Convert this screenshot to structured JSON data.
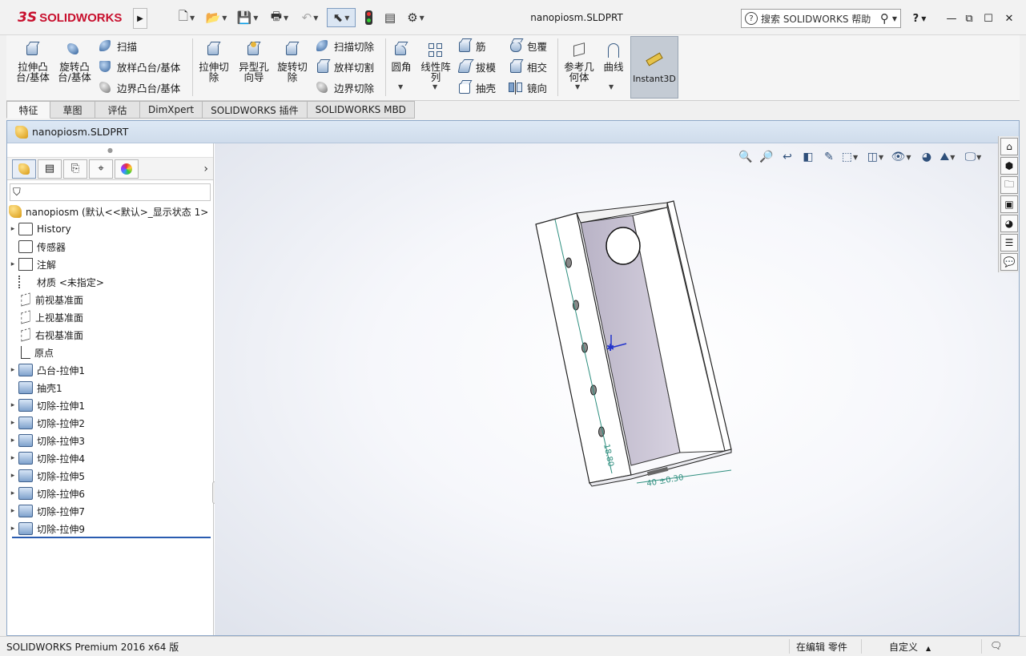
{
  "app": {
    "brand_ds": "3S",
    "brand_name": "SOLIDWORKS",
    "title": "nanopiosm.SLDPRT",
    "help_search_placeholder": "搜索 SOLIDWORKS 帮助",
    "help_label": "?"
  },
  "quick_access": [
    {
      "name": "new-icon",
      "glyph": "🗋"
    },
    {
      "name": "open-icon",
      "glyph": "📂"
    },
    {
      "name": "save-icon",
      "glyph": "💾"
    },
    {
      "name": "print-icon",
      "glyph": "🖶"
    },
    {
      "name": "undo-icon",
      "glyph": "↶"
    },
    {
      "name": "select-icon",
      "glyph": "⬉"
    },
    {
      "name": "traffic-light-icon",
      "glyph": "●"
    },
    {
      "name": "file-properties-icon",
      "glyph": "▤"
    },
    {
      "name": "options-icon",
      "glyph": "⚙"
    }
  ],
  "commands": {
    "extrude_boss": "拉伸凸\n台/基体",
    "revolve_boss": "旋转凸\n台/基体",
    "sweep": "扫描",
    "loft_boss": "放样凸台/基体",
    "boundary_boss": "边界凸台/基体",
    "extrude_cut": "拉伸切\n除",
    "hole_wizard": "异型孔\n向导",
    "revolve_cut": "旋转切\n除",
    "sweep_cut": "扫描切除",
    "loft_cut": "放样切割",
    "boundary_cut": "边界切除",
    "fillet": "圆角",
    "linear_pattern": "线性阵\n列",
    "rib": "筋",
    "draft": "拔模",
    "shell": "抽壳",
    "wrap": "包覆",
    "intersect": "相交",
    "mirror": "镜向",
    "ref_geometry": "参考几\n何体",
    "curves": "曲线",
    "instant3d": "Instant3D"
  },
  "tabs": [
    "特征",
    "草图",
    "评估",
    "DimXpert",
    "SOLIDWORKS 插件",
    "SOLIDWORKS MBD"
  ],
  "document": {
    "window_title": "nanopiosm.SLDPRT"
  },
  "feature_tree": {
    "root": "nanopiosm  (默认<<默认>_显示状态 1>",
    "items": [
      {
        "label": "History",
        "expandable": true,
        "icon": "history-icon"
      },
      {
        "label": "传感器",
        "expandable": false,
        "icon": "sensor-icon"
      },
      {
        "label": "注解",
        "expandable": true,
        "icon": "annotation-icon"
      },
      {
        "label": "材质 <未指定>",
        "expandable": false,
        "icon": "material-icon"
      },
      {
        "label": "前视基准面",
        "expandable": false,
        "icon": "plane-icon"
      },
      {
        "label": "上视基准面",
        "expandable": false,
        "icon": "plane-icon"
      },
      {
        "label": "右视基准面",
        "expandable": false,
        "icon": "plane-icon"
      },
      {
        "label": "原点",
        "expandable": false,
        "icon": "origin-icon"
      },
      {
        "label": "凸台-拉伸1",
        "expandable": true,
        "icon": "boss-extrude-icon"
      },
      {
        "label": "抽壳1",
        "expandable": false,
        "icon": "shell-icon"
      },
      {
        "label": "切除-拉伸1",
        "expandable": true,
        "icon": "cut-extrude-icon"
      },
      {
        "label": "切除-拉伸2",
        "expandable": true,
        "icon": "cut-extrude-icon"
      },
      {
        "label": "切除-拉伸3",
        "expandable": true,
        "icon": "cut-extrude-icon"
      },
      {
        "label": "切除-拉伸4",
        "expandable": true,
        "icon": "cut-extrude-icon"
      },
      {
        "label": "切除-拉伸5",
        "expandable": true,
        "icon": "cut-extrude-icon"
      },
      {
        "label": "切除-拉伸6",
        "expandable": true,
        "icon": "cut-extrude-icon"
      },
      {
        "label": "切除-拉伸7",
        "expandable": true,
        "icon": "cut-extrude-icon"
      },
      {
        "label": "切除-拉伸9",
        "expandable": true,
        "icon": "cut-extrude-icon"
      }
    ]
  },
  "model": {
    "dim_side": "18.80",
    "dim_bottom": "40 ±0.30"
  },
  "status": {
    "product": "SOLIDWORKS Premium 2016 x64 版",
    "mode": "在编辑 零件",
    "units": "自定义"
  },
  "colors": {
    "accent": "#2a5cb0",
    "brand_red": "#c8102e",
    "dimension_teal": "#2f8f7f"
  }
}
